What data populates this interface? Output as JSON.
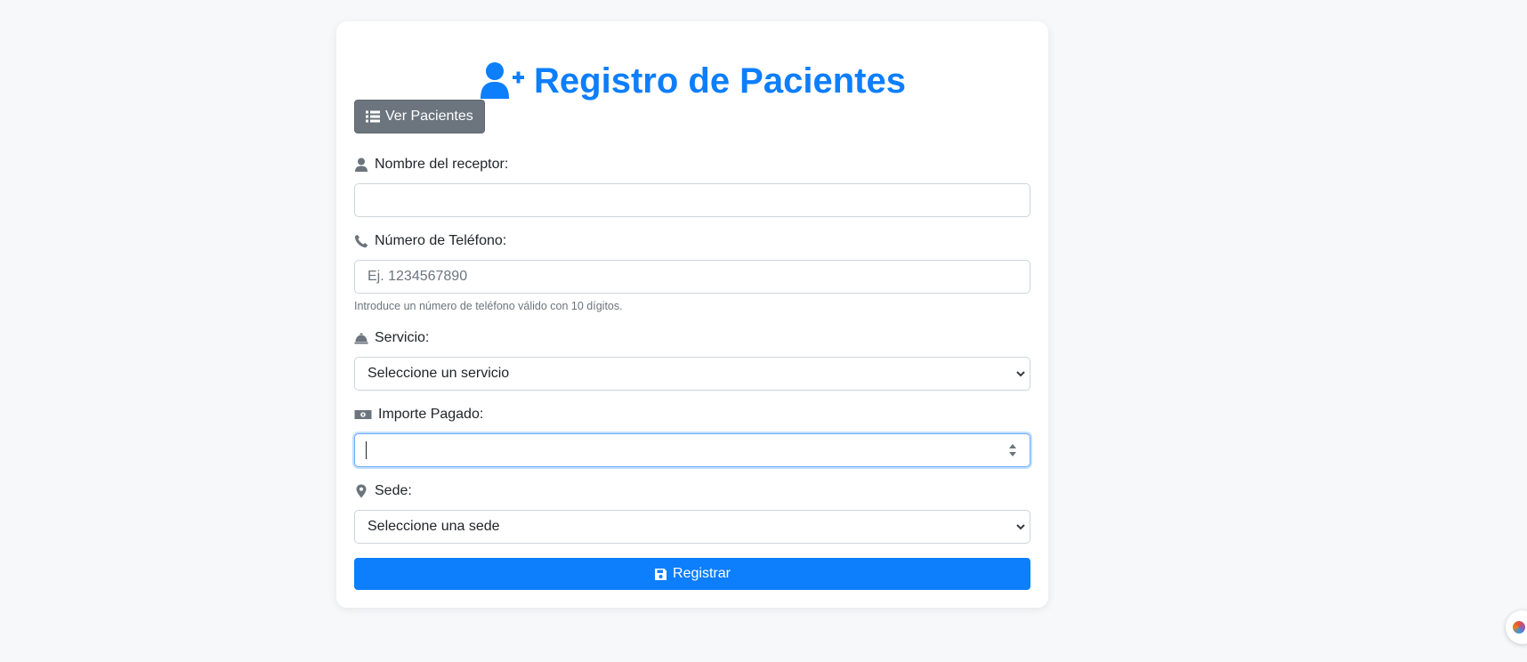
{
  "header": {
    "title": "Registro de Pacientes",
    "icon": "user-plus-icon"
  },
  "toolbar": {
    "view_patients_label": "Ver Pacientes"
  },
  "form": {
    "receptor": {
      "label": "Nombre del receptor:",
      "value": "",
      "placeholder": ""
    },
    "phone": {
      "label": "Número de Teléfono:",
      "value": "",
      "placeholder": "Ej. 1234567890",
      "help": "Introduce un número de teléfono válido con 10 dígitos."
    },
    "service": {
      "label": "Servicio:",
      "selected": "Seleccione un servicio"
    },
    "amount": {
      "label": "Importe Pagado:",
      "value": ""
    },
    "location": {
      "label": "Sede:",
      "selected": "Seleccione una sede"
    },
    "submit_label": "Registrar"
  },
  "colors": {
    "accent": "#0d7efc",
    "secondary_button": "#6c757d",
    "background": "#f7f8fa"
  }
}
